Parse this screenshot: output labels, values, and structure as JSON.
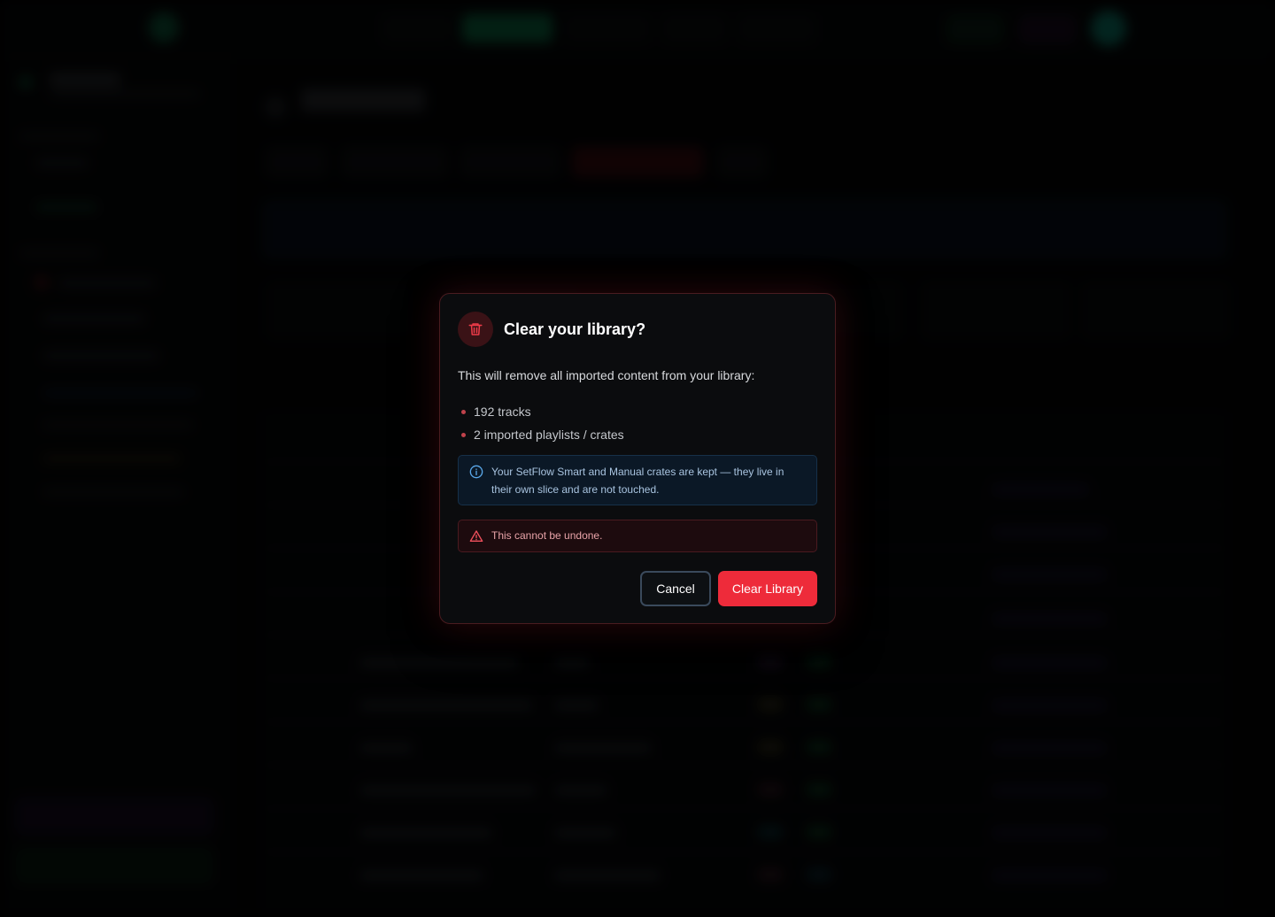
{
  "modal": {
    "title": "Clear your library?",
    "description": "This will remove all imported content from your library:",
    "items": [
      {
        "label": "192 tracks"
      },
      {
        "label": "2 imported playlists / crates"
      }
    ],
    "info": "Your SetFlow Smart and Manual crates are kept — they live in their own slice and are not touched.",
    "warning": "This cannot be undone.",
    "cancel_label": "Cancel",
    "confirm_label": "Clear Library",
    "icons": {
      "header": "trash-icon",
      "info": "info-icon",
      "warning": "warning-triangle-icon"
    }
  },
  "colors": {
    "danger": "#ee2b3a",
    "accent_green": "#0d6b43",
    "info_text": "#a9c4e0",
    "warning_text": "#e8a3a8"
  }
}
